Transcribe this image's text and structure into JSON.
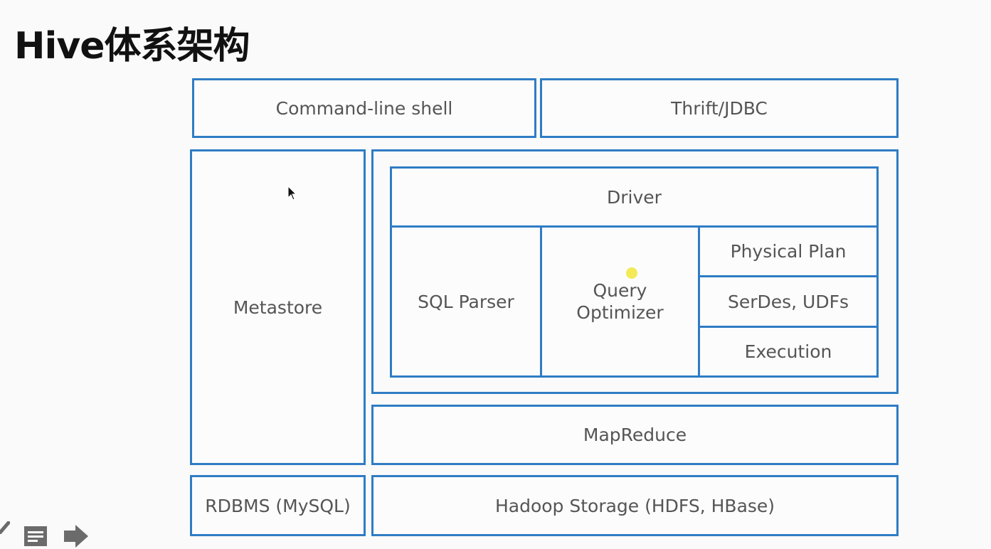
{
  "title": "Hive体系架构",
  "diagram": {
    "command_line_shell": "Command-line shell",
    "thrift_jdbc": "Thrift/JDBC",
    "metastore": "Metastore",
    "driver": "Driver",
    "sql_parser": "SQL Parser",
    "query_optimizer_line1": "Query",
    "query_optimizer_line2": "Optimizer",
    "physical_plan": "Physical Plan",
    "serdes_udfs": "SerDes, UDFs",
    "execution": "Execution",
    "mapreduce": "MapReduce",
    "rdbms": "RDBMS (MySQL)",
    "hadoop_storage": "Hadoop Storage (HDFS, HBase)"
  },
  "colors": {
    "border": "#2f7cc4",
    "text": "#555555"
  },
  "controls": [
    "pen-icon",
    "notes-icon",
    "next-arrow-icon"
  ]
}
